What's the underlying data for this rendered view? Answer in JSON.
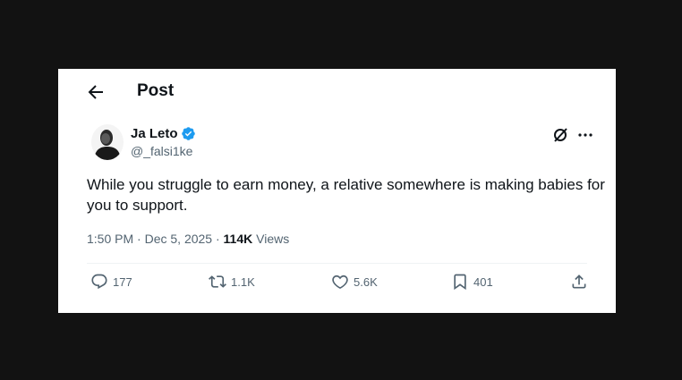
{
  "header": {
    "title": "Post"
  },
  "author": {
    "name": "Ja Leto",
    "handle": "@_falsi1ke"
  },
  "tweet": {
    "text": "While you struggle to earn money, a relative somewhere is making babies for you to support.",
    "time": "1:50 PM",
    "separator1": "·",
    "date": "Dec 5, 2025",
    "separator2": "·",
    "views_count": "114K",
    "views_label": "Views"
  },
  "actions": {
    "replies": "177",
    "reposts": "1.1K",
    "likes": "5.6K",
    "bookmarks": "401"
  },
  "icons": [
    "back-arrow-icon",
    "verified-badge-icon",
    "grok-icon",
    "more-icon",
    "reply-icon",
    "repost-icon",
    "like-icon",
    "bookmark-icon",
    "share-icon"
  ],
  "colors": {
    "verified": "#1d9bf0",
    "text": "#0f1419",
    "muted": "#536471"
  }
}
